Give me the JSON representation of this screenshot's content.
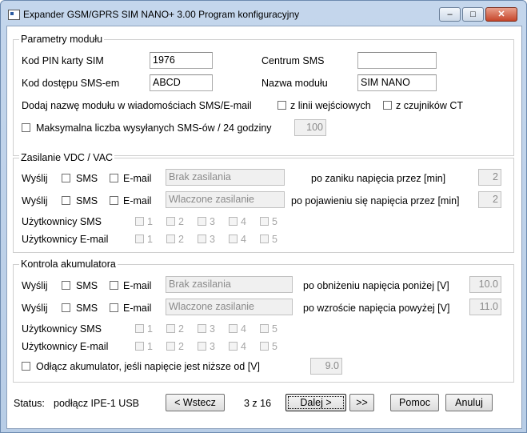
{
  "window": {
    "title": "Expander GSM/GPRS SIM NANO+ 3.00 Program konfiguracyjny",
    "controls": {
      "minimize": "–",
      "maximize": "□",
      "close": "✕"
    }
  },
  "params": {
    "group_title": "Parametry modułu",
    "pin_label": "Kod PIN karty SIM",
    "pin_value": "1976",
    "sms_center_label": "Centrum SMS",
    "sms_center_value": "",
    "sms_code_label": "Kod dostępu SMS-em",
    "sms_code_value": "ABCD",
    "module_name_label": "Nazwa modułu",
    "module_name_value": "SIM NANO",
    "add_name_label": "Dodaj nazwę modułu w wiadomościach SMS/E-mail",
    "from_inputs_label": "z linii wejściowych",
    "from_ct_label": "z czujników CT",
    "max_sms_label": "Maksymalna liczba wysyłanych SMS-ów / 24 godziny",
    "max_sms_value": "100"
  },
  "power": {
    "group_title": "Zasilanie VDC / VAC",
    "send_label": "Wyślij",
    "sms_label": "SMS",
    "email_label": "E-mail",
    "loss_text": "Brak zasilania",
    "on_text": "Wlaczone zasilanie",
    "after_loss_label": "po zaniku napięcia przez [min]",
    "after_loss_value": "2",
    "after_return_label": "po pojawieniu się napięcia przez [min]",
    "after_return_value": "2",
    "users_sms_label": "Użytkownicy SMS",
    "users_email_label": "Użytkownicy E-mail",
    "user_numbers": [
      "1",
      "2",
      "3",
      "4",
      "5"
    ]
  },
  "battery": {
    "group_title": "Kontrola akumulatora",
    "send_label": "Wyślij",
    "sms_label": "SMS",
    "email_label": "E-mail",
    "loss_text": "Brak zasilania",
    "on_text": "Wlaczone zasilanie",
    "drop_label": "po obniżeniu napięcia poniżej [V]",
    "drop_value": "10.0",
    "rise_label": "po wzroście napięcia powyżej [V]",
    "rise_value": "11.0",
    "users_sms_label": "Użytkownicy SMS",
    "users_email_label": "Użytkownicy E-mail",
    "user_numbers": [
      "1",
      "2",
      "3",
      "4",
      "5"
    ],
    "disconnect_label": "Odłącz akumulator, jeśli napięcie jest niższe od [V]",
    "disconnect_value": "9.0"
  },
  "footer": {
    "status_label": "Status:",
    "status_value": "podłącz IPE-1 USB",
    "back_label": "< Wstecz",
    "page_indicator": "3 z 16",
    "next_label": "Dalej >",
    "last_label": ">>",
    "help_label": "Pomoc",
    "cancel_label": "Anuluj"
  }
}
